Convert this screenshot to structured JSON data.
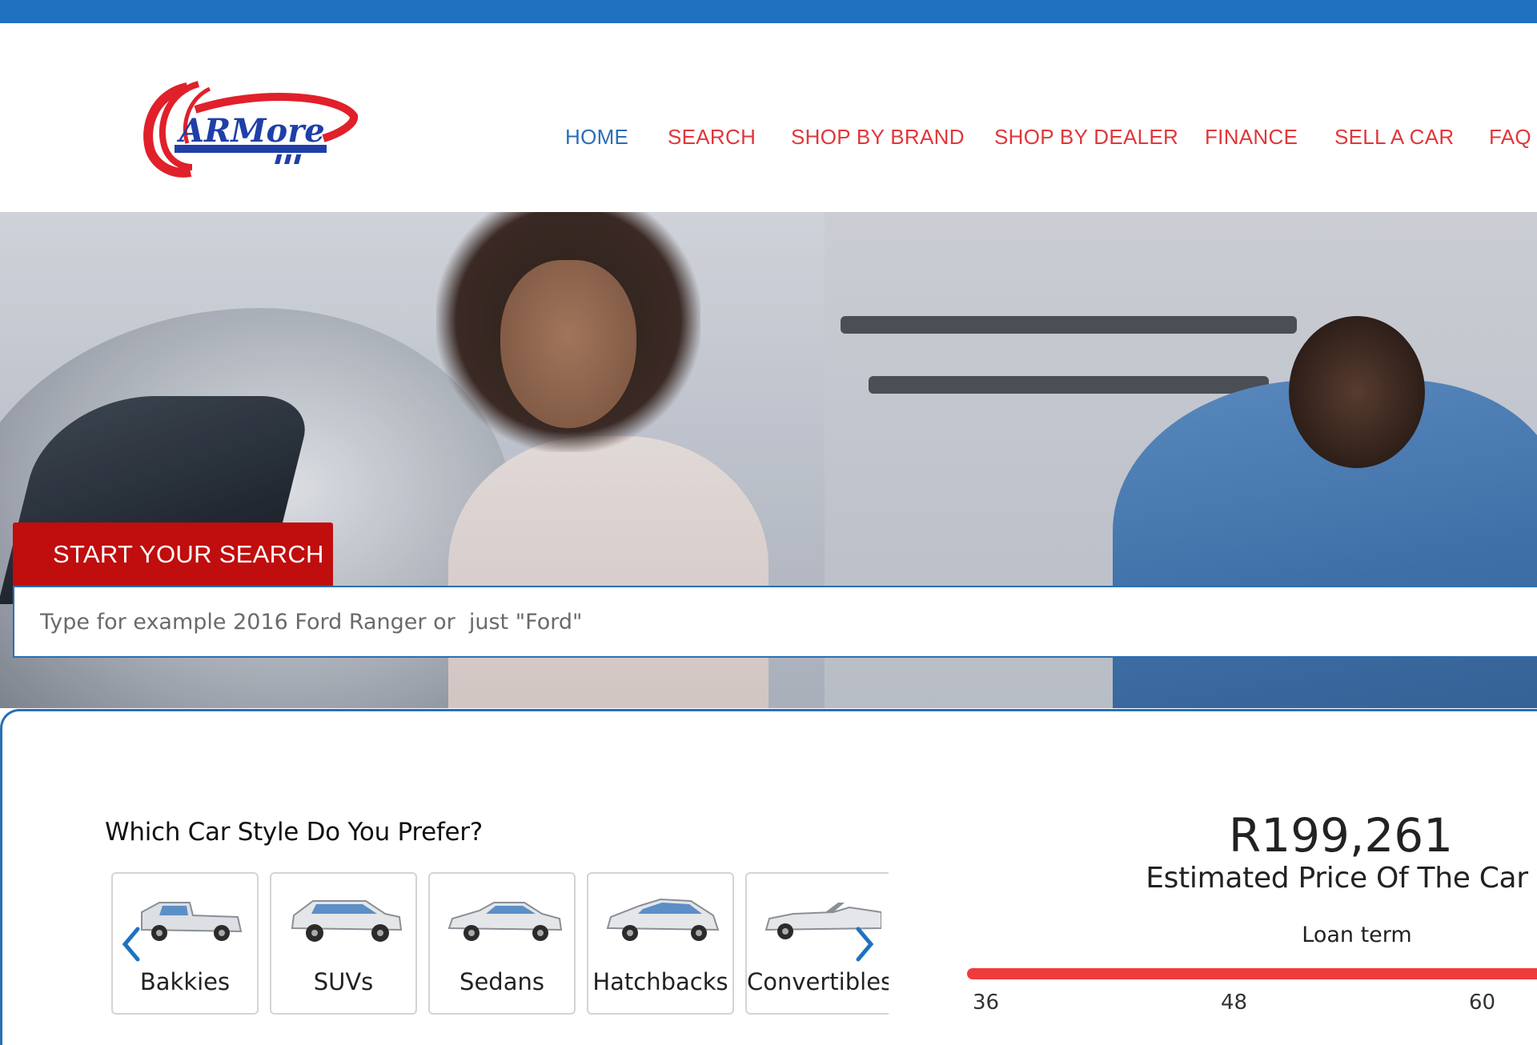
{
  "brand": {
    "logo_text": "ARMore",
    "colors": {
      "red": "#e0373a",
      "blue": "#1f72bf",
      "dark_red": "#c00d0d"
    }
  },
  "nav": {
    "items": [
      {
        "label": "HOME",
        "active": true
      },
      {
        "label": "SEARCH",
        "active": false
      },
      {
        "label": "SHOP BY BRAND",
        "active": false
      },
      {
        "label": "SHOP BY DEALER",
        "active": false
      },
      {
        "label": "FINANCE",
        "active": false
      },
      {
        "label": "SELL A CAR",
        "active": false
      },
      {
        "label": "FAQ",
        "active": false
      }
    ]
  },
  "search": {
    "tab_label": "START YOUR SEARCH",
    "placeholder": "Type for example 2016 Ford Ranger or  just \"Ford\""
  },
  "styles": {
    "title": "Which Car Style Do You Prefer?",
    "items": [
      {
        "label": "Bakkies",
        "icon": "bakkie-icon"
      },
      {
        "label": "SUVs",
        "icon": "suv-icon"
      },
      {
        "label": "Sedans",
        "icon": "sedan-icon"
      },
      {
        "label": "Hatchbacks",
        "icon": "hatchback-icon"
      },
      {
        "label": "Convertibles",
        "icon": "convertible-icon"
      }
    ],
    "prev_icon": "chevron-left-icon",
    "next_icon": "chevron-right-icon"
  },
  "finance": {
    "price": "R199,261",
    "price_label": "Estimated Price Of The Car",
    "loan_label": "Loan term",
    "ticks": [
      "36",
      "48",
      "60"
    ]
  }
}
